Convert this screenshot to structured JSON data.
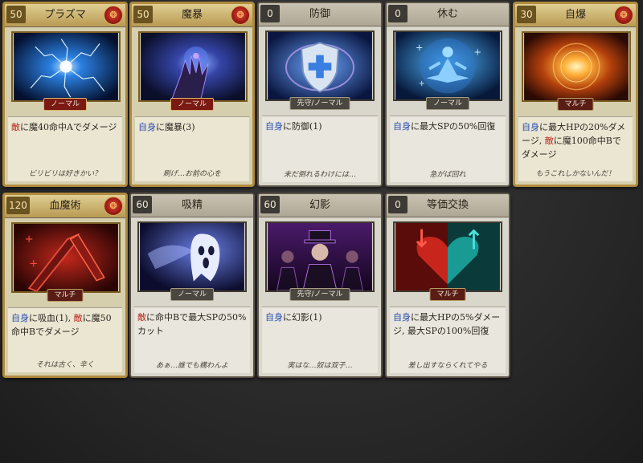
{
  "cards": [
    {
      "cost": "50",
      "name": "プラズマ",
      "type": "ノーマル",
      "target": "敵",
      "target_kind": "enemy",
      "effect": "に魔40命中Aでダメージ",
      "flavor": "ビリビリは好きかい？",
      "icon": "plasma-art",
      "emblem": "lion-emblem"
    },
    {
      "cost": "50",
      "name": "魔暴",
      "type": "ノーマル",
      "target": "自身",
      "target_kind": "self",
      "effect": "に魔暴(3)",
      "flavor": "刷げ…お前の心を",
      "icon": "dark-hand-art",
      "emblem": "lion-emblem"
    },
    {
      "cost": "0",
      "name": "防御",
      "type": "先守/ノーマル",
      "target": "自身",
      "target_kind": "self",
      "effect": "に防御(1)",
      "flavor": "未だ倒れるわけには…",
      "icon": "shield-art"
    },
    {
      "cost": "0",
      "name": "休む",
      "type": "ノーマル",
      "target": "自身",
      "target_kind": "self",
      "effect": "に最大SPの50%回復",
      "flavor": "急がば回れ",
      "icon": "meditate-art"
    },
    {
      "cost": "30",
      "name": "自爆",
      "type": "マルチ",
      "target": "自身",
      "target_kind": "self",
      "effect_parts": [
        "に最大HPの20%ダメージ, ",
        "敵",
        "に魔100命中Bでダメージ"
      ],
      "flavor": "もうこれしかないんだ！",
      "icon": "explosion-art",
      "emblem": "lion-emblem"
    },
    {
      "cost": "120",
      "name": "血魔術",
      "type": "マルチ",
      "target": "自身",
      "target_kind": "self",
      "effect_parts": [
        "に吸血(1), ",
        "敵",
        "に魔50命中Bでダメージ"
      ],
      "flavor": "それは古く、辛く",
      "icon": "blood-blade-art",
      "emblem": "lion-emblem"
    },
    {
      "cost": "60",
      "name": "吸精",
      "type": "ノーマル",
      "target": "敵",
      "target_kind": "enemy",
      "effect": "に命中Bで最大SPの50%カット",
      "flavor": "あぁ…誰でも構わんよ",
      "icon": "ghost-art"
    },
    {
      "cost": "60",
      "name": "幻影",
      "type": "先守/ノーマル",
      "target": "自身",
      "target_kind": "self",
      "effect": "に幻影(1)",
      "flavor": "実はな…奴は双子…",
      "icon": "phantom-art"
    },
    {
      "cost": "0",
      "name": "等価交換",
      "type": "マルチ",
      "target": "自身",
      "target_kind": "self",
      "effect": "に最大HPの5%ダメージ, 最大SPの100%回復",
      "flavor": "差し出すならくれてやる",
      "icon": "exchange-heart-art"
    }
  ],
  "colors": {
    "self": "#2b4fb3",
    "enemy": "#b8261a",
    "gold_border": "#b08a3e"
  }
}
